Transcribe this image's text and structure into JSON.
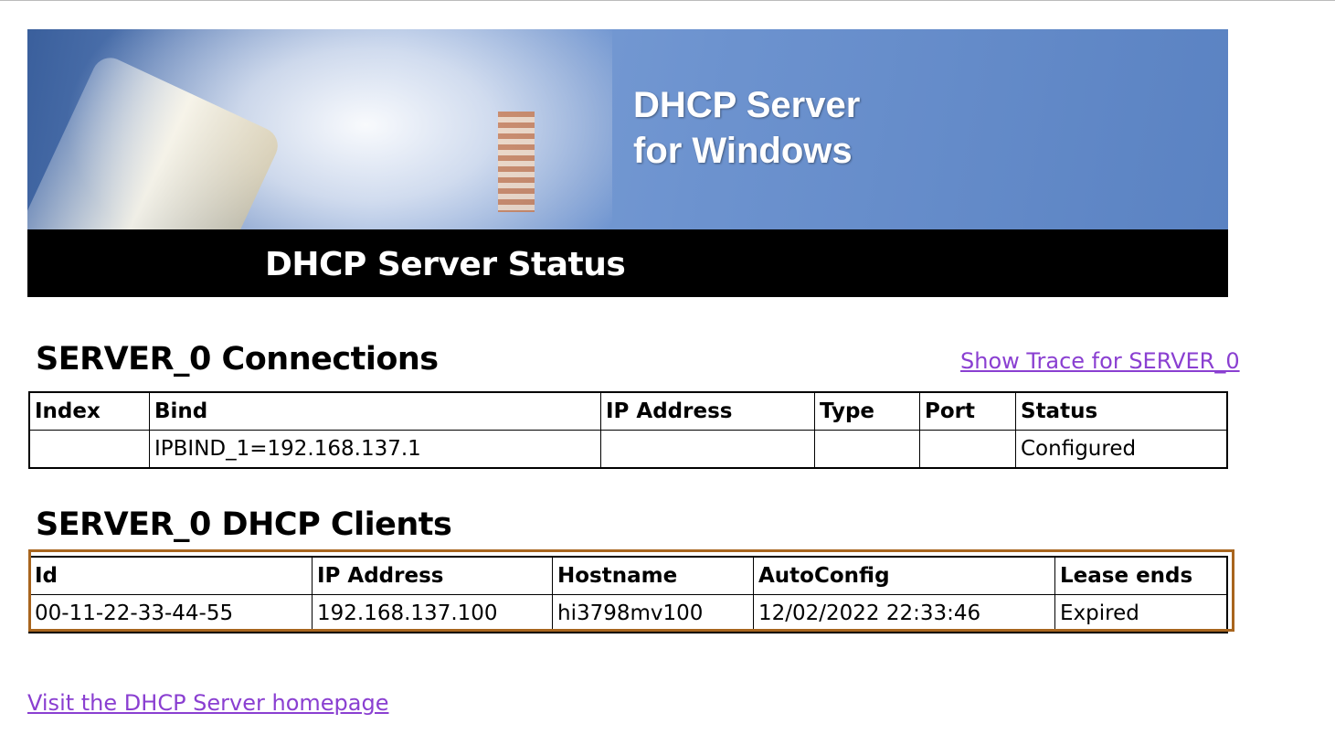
{
  "banner": {
    "brand_line1": "DHCP Server",
    "brand_line2": "for Windows",
    "title": "DHCP Server Status"
  },
  "connections": {
    "heading": "SERVER_0 Connections",
    "trace_link": "Show Trace for SERVER_0",
    "columns": [
      "Index",
      "Bind",
      "IP Address",
      "Type",
      "Port",
      "Status"
    ],
    "rows": [
      [
        "",
        "IPBIND_1=192.168.137.1",
        "",
        "",
        "",
        "Configured"
      ]
    ]
  },
  "clients": {
    "heading": "SERVER_0 DHCP Clients",
    "columns": [
      "Id",
      "IP Address",
      "Hostname",
      "AutoConfig",
      "Lease ends"
    ],
    "rows": [
      [
        "00-11-22-33-44-55",
        "192.168.137.100",
        "hi3798mv100",
        "12/02/2022 22:33:46",
        "Expired"
      ]
    ]
  },
  "footer": {
    "homepage_link": "Visit the DHCP Server homepage"
  },
  "colors": {
    "link": "#8a3fd1",
    "highlight": "#a8651e"
  }
}
